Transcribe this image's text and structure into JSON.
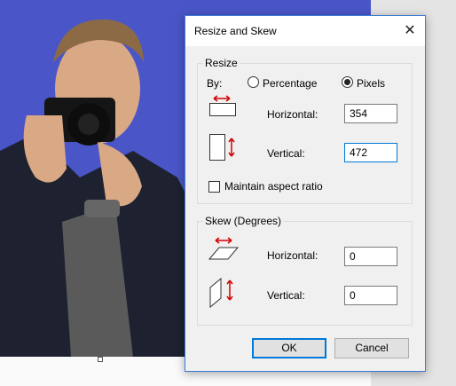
{
  "dialog": {
    "title": "Resize and Skew",
    "close_glyph": "✕"
  },
  "resize": {
    "group_label": "Resize",
    "by_label": "By:",
    "percentage_label": "Percentage",
    "pixels_label": "Pixels",
    "selected_mode": "Pixels",
    "horizontal_label": "Horizontal:",
    "horizontal_value": "354",
    "vertical_label": "Vertical:",
    "vertical_value": "472",
    "maintain_label": "Maintain aspect ratio",
    "maintain_checked": false
  },
  "skew": {
    "group_label": "Skew (Degrees)",
    "horizontal_label": "Horizontal:",
    "horizontal_value": "0",
    "vertical_label": "Vertical:",
    "vertical_value": "0"
  },
  "buttons": {
    "ok_label": "OK",
    "cancel_label": "Cancel"
  },
  "colors": {
    "canvas_background": "#4a56c8",
    "dialog_border": "#3a7bd5",
    "arrow_red": "#d00000"
  }
}
